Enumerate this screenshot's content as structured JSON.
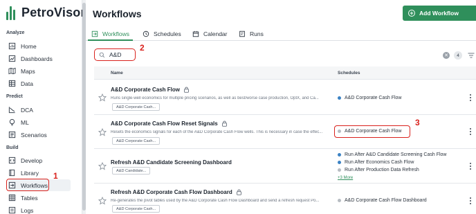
{
  "brand": {
    "name": "PetroVisor",
    "accent": "#2f8f5b",
    "annotation_color": "#d9211c"
  },
  "sidebar": {
    "sections": [
      {
        "label": "Analyze",
        "items": [
          {
            "label": "Home",
            "icon": "home-icon"
          },
          {
            "label": "Dashboards",
            "icon": "dashboards-icon"
          },
          {
            "label": "Maps",
            "icon": "map-icon"
          },
          {
            "label": "Data",
            "icon": "table-icon"
          }
        ]
      },
      {
        "label": "Predict",
        "items": [
          {
            "label": "DCA",
            "icon": "chart-line-icon"
          },
          {
            "label": "ML",
            "icon": "lightbulb-icon"
          },
          {
            "label": "Scenarios",
            "icon": "scenarios-icon"
          }
        ]
      },
      {
        "label": "Build",
        "items": [
          {
            "label": "Develop",
            "icon": "code-icon"
          },
          {
            "label": "Library",
            "icon": "book-icon"
          },
          {
            "label": "Workflows",
            "icon": "workflows-icon",
            "active": true
          },
          {
            "label": "Tables",
            "icon": "grid-icon"
          },
          {
            "label": "Logs",
            "icon": "list-icon"
          }
        ]
      }
    ]
  },
  "header": {
    "title": "Workflows",
    "add_button": "Add Workflow"
  },
  "tabs": [
    {
      "label": "Workflows",
      "icon": "workflow-tab-icon",
      "active": true
    },
    {
      "label": "Schedules",
      "icon": "clock-icon"
    },
    {
      "label": "Calendar",
      "icon": "calendar-icon"
    },
    {
      "label": "Runs",
      "icon": "runs-icon"
    }
  ],
  "search": {
    "value": "A&D",
    "result_count": "4"
  },
  "table": {
    "columns": [
      "Name",
      "Schedules"
    ],
    "rows": [
      {
        "name": "A&D Corporate Cash Flow",
        "locked": true,
        "description": "Runs single-well economics for multiple pricing scenarios, as well as best/worse case production, OptX, and Ca...",
        "tag": "A&D Corporate Cash...",
        "schedules": [
          {
            "label": "A&D Corporate Cash Flow",
            "status": "#3b82c4"
          }
        ]
      },
      {
        "name": "A&D Corporate Cash Flow Reset Signals",
        "locked": true,
        "description": "Resets the economics signals for each of the A&D Corporate Cash Flow wells. This is necessary in case the effec...",
        "tag": "A&D Corporate Cash...",
        "schedules": [
          {
            "label": "A&D Corporate Cash Flow",
            "status": "#b7bcc2"
          }
        ]
      },
      {
        "name": "Refresh A&D Candidate Screening Dashboard",
        "locked": false,
        "description": "",
        "tag": "A&D Candidate...",
        "schedules": [
          {
            "label": "Run After A&D Candidate Screening Cash Flow",
            "status": "#3b82c4"
          },
          {
            "label": "Run After Economics Cash Flow",
            "status": "#3b82c4"
          },
          {
            "label": "Run After Production Data Refresh",
            "status": "#b7bcc2"
          }
        ],
        "more": "+3 More"
      },
      {
        "name": "Refresh A&D Corporate Cash Flow Dashboard",
        "locked": true,
        "description": "Re-generates the pivot tables used by the A&D Corporate Cash Flow Dashboard and send a refresh request Po...",
        "tag": "A&D Corporate Cash...",
        "schedules": [
          {
            "label": "A&D Corporate Cash Flow Dashboard",
            "status": "#b7bcc2"
          }
        ]
      }
    ]
  },
  "annotations": [
    "1",
    "2",
    "3"
  ]
}
